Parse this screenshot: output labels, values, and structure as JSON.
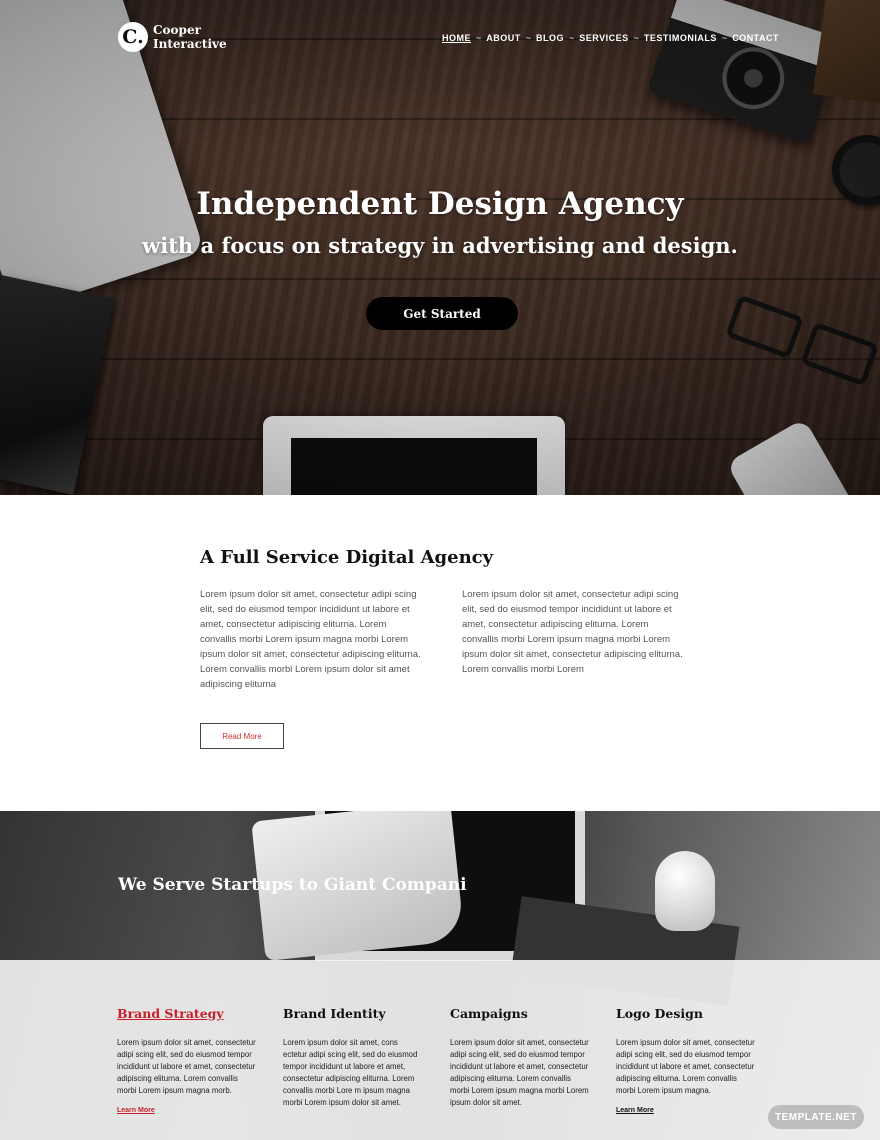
{
  "brand": {
    "mark": "C.",
    "name_line1": "Cooper",
    "name_line2": "Interactive"
  },
  "nav": {
    "items": [
      {
        "label": "HOME"
      },
      {
        "label": "ABOUT"
      },
      {
        "label": "BLOG"
      },
      {
        "label": "SERVICES"
      },
      {
        "label": "TESTIMONIALS"
      },
      {
        "label": "CONTACT"
      }
    ],
    "separator": "~"
  },
  "hero": {
    "title": "Independent Design Agency",
    "subtitle": "with a focus on strategy in advertising and design.",
    "cta_label": "Get Started"
  },
  "about": {
    "title": "A Full Service Digital Agency",
    "col1": "Lorem ipsum dolor sit amet, consectetur adipi scing elit, sed do eiusmod tempor incididunt ut labore et amet, consectetur adipiscing eliturna. Lorem convallis morbi Lorem ipsum magna morbi Lorem ipsum dolor sit amet, consectetur adipiscing eliturna. Lorem convallis morbi Lorem ipsum dolor sit amet adipiscing eliturna",
    "col2": "Lorem ipsum dolor sit amet, consectetur adipi scing elit, sed do eiusmod tempor incididunt ut labore et amet, consectetur adipiscing eliturna. Lorem convallis morbi Lorem ipsum magna morbi Lorem ipsum dolor sit amet, consectetur adipiscing eliturna. Lorem convallis morbi Lorem",
    "read_more": "Read More"
  },
  "services_banner": {
    "title": "We Serve Startups to Giant Compani"
  },
  "services": [
    {
      "title": "Brand Strategy",
      "text": "Lorem ipsum dolor sit amet, consectetur adipi scing elit, sed do eiusmod tempor incididunt ut labore et amet, consectetur adipiscing eliturna. Lorem convallis morbi Lorem ipsum magna morb.",
      "link": "Learn More"
    },
    {
      "title": "Brand Identity",
      "text": "Lorem ipsum dolor sit amet, cons ectetur adipi scing elit, sed do eiusmod tempor incididunt ut labore et amet, consectetur adipiscing eliturna. Lorem convallis morbi Lore m ipsum magna morbi Lorem ipsum dolor sit amet.",
      "link": ""
    },
    {
      "title": "Campaigns",
      "text": "Lorem ipsum dolor sit amet, consectetur adipi scing elit, sed do eiusmod tempor incididunt ut labore et amet, consectetur adipiscing eliturna. Lorem convallis morbi Lorem ipsum magna morbi Lorem ipsum dolor sit amet.",
      "link": ""
    },
    {
      "title": "Logo Design",
      "text": "Lorem ipsum dolor sit amet, consectetur adipi scing elit, sed do eiusmod tempor incididunt ut labore et amet, consectetur adipiscing eliturna. Lorem convallis morbi Lorem ipsum magna.",
      "link": "Learn More"
    }
  ],
  "watermark": "TEMPLATE.NET",
  "colors": {
    "accent_red": "#c8202a",
    "hero_wood": "#3a2a22",
    "cta_bg": "#000000"
  }
}
